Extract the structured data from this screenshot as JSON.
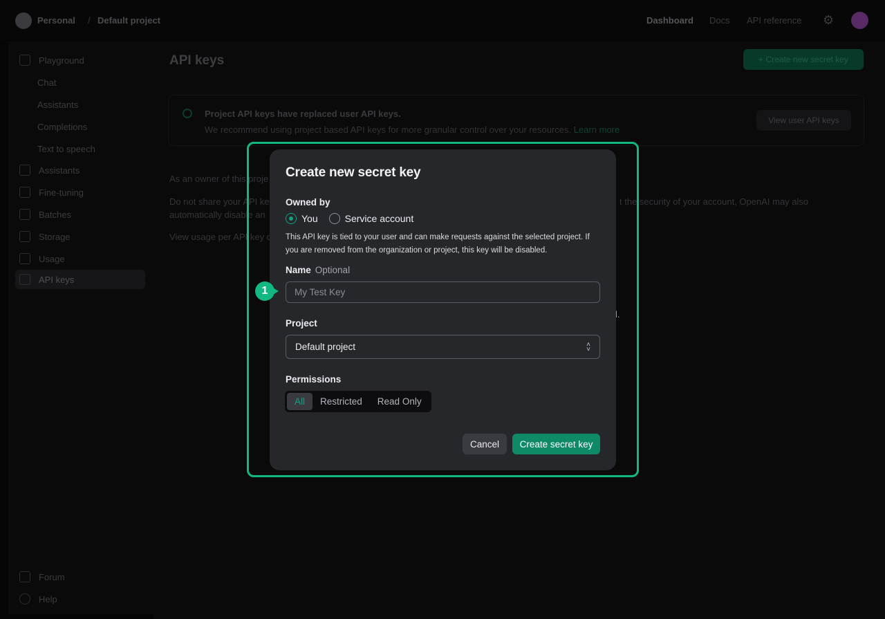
{
  "topbar": {
    "org": "Personal",
    "separator": "/",
    "project": "Default project",
    "nav": [
      "Dashboard",
      "Docs",
      "API reference"
    ]
  },
  "sidebar": {
    "items": [
      {
        "label": "Playground",
        "icon": "terminal-icon",
        "sub": false
      },
      {
        "label": "Chat",
        "sub": true
      },
      {
        "label": "Assistants",
        "sub": true
      },
      {
        "label": "Completions",
        "sub": true
      },
      {
        "label": "Text to speech",
        "sub": true
      },
      {
        "label": "Assistants",
        "icon": "assistant-icon",
        "sub": false
      },
      {
        "label": "Fine-tuning",
        "icon": "sliders-icon",
        "sub": false
      },
      {
        "label": "Batches",
        "icon": "batch-icon",
        "sub": false
      },
      {
        "label": "Storage",
        "icon": "database-icon",
        "sub": false
      },
      {
        "label": "Usage",
        "icon": "chart-icon",
        "sub": false
      },
      {
        "label": "API keys",
        "icon": "lock-icon",
        "sub": false
      }
    ],
    "footer": [
      {
        "label": "Forum",
        "icon": "forum-icon"
      },
      {
        "label": "Help",
        "icon": "help-icon"
      }
    ]
  },
  "page": {
    "title": "API keys",
    "create_button": "+ Create new secret key",
    "banner_title": "Project API keys have replaced user API keys.",
    "banner_text": "We recommend using project based API keys for more granular control over your resources.",
    "banner_link": "Learn more",
    "banner_button": "View user API keys",
    "para1": "As an owner of this proje",
    "para2a": "Do not share your API ke",
    "para2b": "automatically disable an",
    "para2c": "t the security of your account, OpenAI may also",
    "para3": "View usage per API key o",
    "para4": "l."
  },
  "modal": {
    "title": "Create new secret key",
    "owned_by_label": "Owned by",
    "owner_options": [
      "You",
      "Service account"
    ],
    "owner_selected": "You",
    "helper": "This API key is tied to your user and can make requests against the selected project. If you are removed from the organization or project, this key will be disabled.",
    "name_label": "Name",
    "name_optional": "Optional",
    "name_placeholder": "My Test Key",
    "name_value": "",
    "project_label": "Project",
    "project_value": "Default project",
    "permissions_label": "Permissions",
    "permissions": [
      "All",
      "Restricted",
      "Read Only"
    ],
    "permissions_selected": "All",
    "cancel": "Cancel",
    "create": "Create secret key"
  },
  "annotation": {
    "step": "1",
    "color": "#10b981"
  },
  "colors": {
    "accent": "#10a37f",
    "highlight": "#10b981",
    "modal_bg": "#26272b"
  }
}
